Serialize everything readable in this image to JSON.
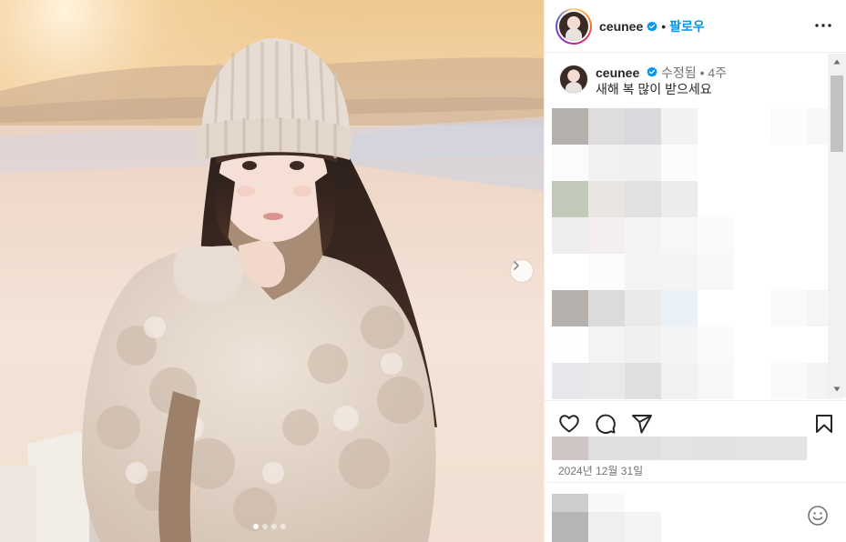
{
  "post": {
    "photo_alt_icon": "next-arrow-icon",
    "carousel_count": 4,
    "carousel_active": 1
  },
  "header": {
    "username": "ceunee",
    "separator": "•",
    "follow_label": "팔로우",
    "more_icon": "more-horizontal-icon"
  },
  "caption": {
    "username": "ceunee",
    "edited_label": "수정됨",
    "separator": "•",
    "age": "4주",
    "text": "새해 복 많이 받으세요"
  },
  "footer": {
    "date": "2024년 12월 31일"
  },
  "colors": {
    "accent": "#0095f6",
    "verified": "#0095f6",
    "text": "#262626",
    "muted": "#737373"
  }
}
